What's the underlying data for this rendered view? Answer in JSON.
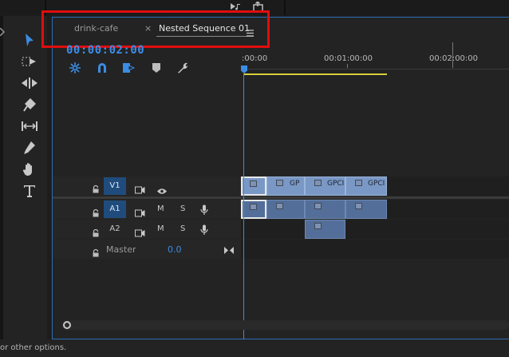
{
  "tabs": [
    {
      "label": "drink-cafe"
    },
    {
      "label": "Nested Sequence 01"
    }
  ],
  "timecode": "00:00:02:00",
  "ruler": {
    "labels": [
      ":00:00",
      "00:01:00:00",
      "00:02:00:00"
    ]
  },
  "tracks": {
    "video": [
      {
        "label": "V1",
        "clips": [
          {
            "name": ""
          },
          {
            "name": "GP"
          },
          {
            "name": "GPCI"
          },
          {
            "name": "GPCI"
          }
        ]
      }
    ],
    "audio": [
      {
        "label": "A1",
        "mute": "M",
        "solo": "S"
      },
      {
        "label": "A2",
        "mute": "M",
        "solo": "S"
      }
    ],
    "master": {
      "label": "Master",
      "value": "0.0"
    }
  },
  "status_text": "or other options.",
  "colors": {
    "accent": "#3b8ce3",
    "work_area_bar": "#d8cf3a",
    "highlight_box": "#e00d0d",
    "video_clip": "#7a98c6",
    "audio_clip": "#536e98"
  }
}
